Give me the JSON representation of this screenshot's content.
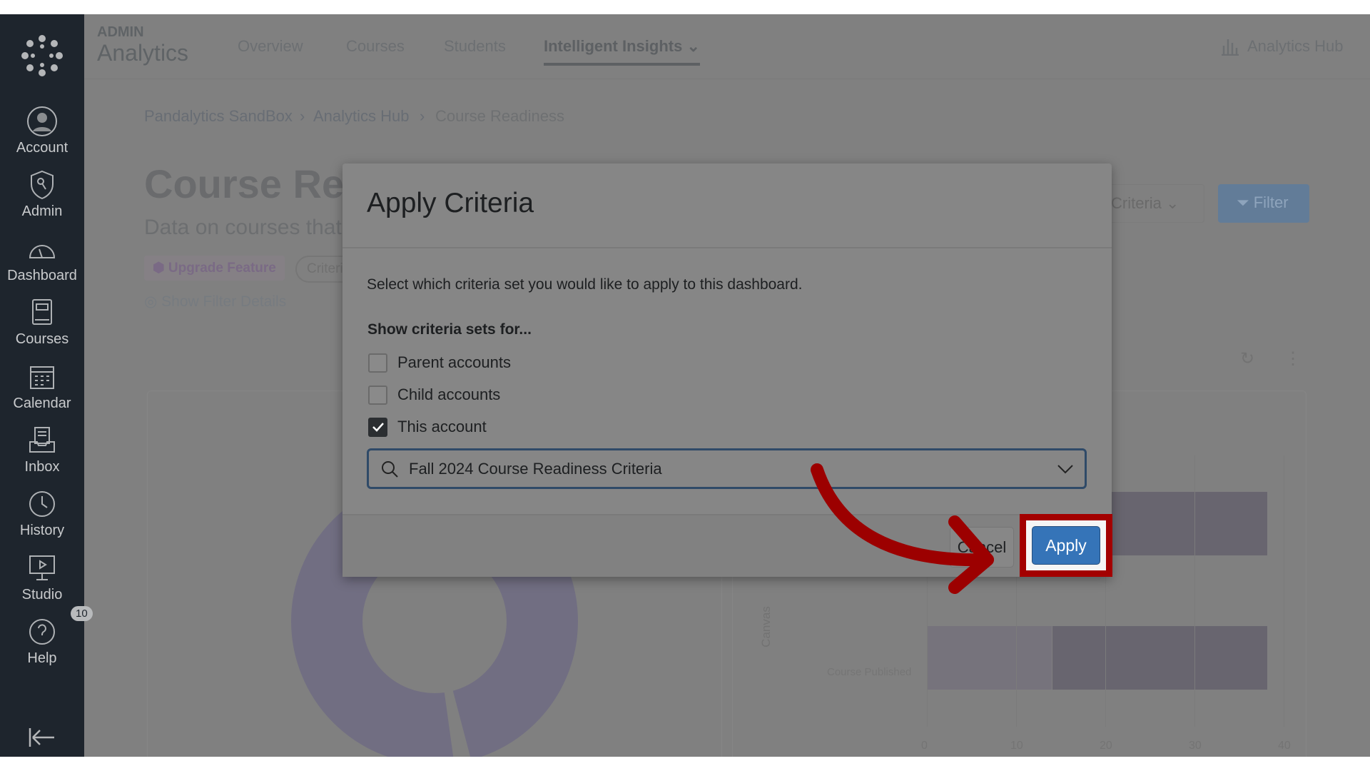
{
  "sidebar": {
    "items": [
      {
        "label": "Account",
        "icon": "account-icon"
      },
      {
        "label": "Admin",
        "icon": "admin-icon"
      },
      {
        "label": "Dashboard",
        "icon": "dashboard-icon"
      },
      {
        "label": "Courses",
        "icon": "courses-icon"
      },
      {
        "label": "Calendar",
        "icon": "calendar-icon"
      },
      {
        "label": "Inbox",
        "icon": "inbox-icon"
      },
      {
        "label": "History",
        "icon": "history-icon"
      },
      {
        "label": "Studio",
        "icon": "studio-icon"
      },
      {
        "label": "Help",
        "icon": "help-icon",
        "badge": "10"
      }
    ]
  },
  "header": {
    "brand_small": "ADMIN",
    "brand": "Analytics",
    "tabs": [
      "Overview",
      "Courses",
      "Students",
      "Intelligent Insights"
    ],
    "active_tab": "Intelligent Insights",
    "hub_link": "Analytics Hub"
  },
  "breadcrumb": [
    "Pandalytics SandBox",
    "Analytics Hub",
    "Course Readiness"
  ],
  "page": {
    "title": "Course Readiness",
    "subtitle": "Data on courses that",
    "upgrade_chip": "Upgrade Feature",
    "criteria_chip": "Criteria",
    "show_filter": "Show Filter Details",
    "criteria_dropdown": "Criteria",
    "filter_button": "Filter"
  },
  "chart": {
    "axis_label": "Canvas",
    "category": "Course Published",
    "ticks": [
      "0",
      "10",
      "20",
      "30",
      "40"
    ]
  },
  "modal": {
    "title": "Apply Criteria",
    "description": "Select which criteria set you would like to apply to this dashboard.",
    "show_for_label": "Show criteria sets for...",
    "checkboxes": [
      {
        "label": "Parent accounts",
        "checked": false
      },
      {
        "label": "Child accounts",
        "checked": false
      },
      {
        "label": "This account",
        "checked": true
      }
    ],
    "select_value": "Fall 2024 Course Readiness Criteria",
    "cancel": "Cancel",
    "apply": "Apply"
  },
  "colors": {
    "accent": "#3574b8",
    "highlight": "#a30000"
  }
}
